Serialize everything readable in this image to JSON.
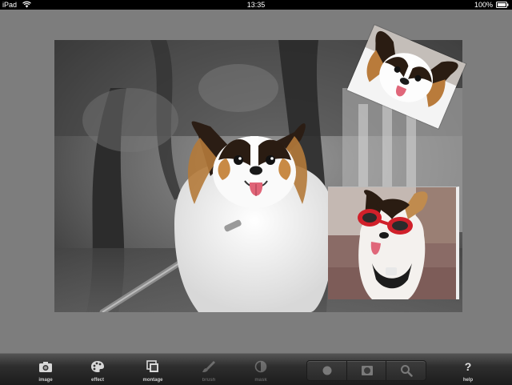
{
  "status_bar": {
    "carrier": "iPad",
    "time": "13:35",
    "battery": "100%"
  },
  "canvas": {
    "main_photo": "papillon-dog-grayscale-background",
    "top_photo": "papillon-dog-closeup",
    "right_photo": "papillon-dog-red-goggles"
  },
  "toolbar": {
    "image_label": "image",
    "effect_label": "effect",
    "montage_label": "montage",
    "brush_label": "brush",
    "mask_label": "mask",
    "help_label": "help",
    "help_glyph": "?"
  },
  "colors": {
    "background": "#7d7d7d",
    "toolbar": "#2e2e2e",
    "goggles": "#d0202a"
  }
}
